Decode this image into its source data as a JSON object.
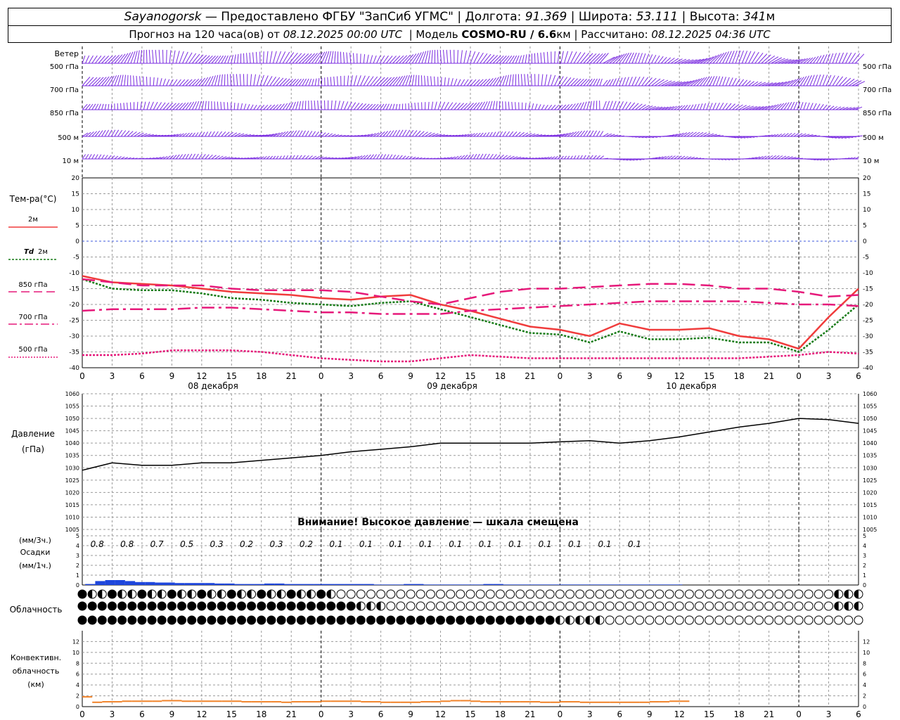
{
  "header": {
    "station": "Sayanogorsk",
    "provider": "— Предоставлено ФГБУ \"ЗапСиб УГМС\"",
    "lon_label": "Долгота:",
    "lon_value": "91.369",
    "lat_label": "Широта:",
    "lat_value": "53.111",
    "alt_label": "Высота:",
    "alt_value": "341",
    "alt_unit": "м",
    "forecast_label": "Прогноз на 120 часа(ов) от",
    "forecast_time": "08.12.2025 00:00 UTC",
    "model_label": "| Модель",
    "model_name": "COSMO-RU / 6.6",
    "model_unit": "км",
    "calc_label": "| Рассчитано:",
    "calc_time": "08.12.2025 04:36 UTC"
  },
  "wind_panel": {
    "title": "Ветер",
    "levels": [
      "500 гПа",
      "700 гПа",
      "850 гПа",
      "500 м",
      "10 м"
    ]
  },
  "time_axis": {
    "hour_labels": [
      "0",
      "3",
      "6",
      "9",
      "12",
      "15",
      "18",
      "21",
      "0",
      "3",
      "6",
      "9",
      "12",
      "15",
      "18",
      "21",
      "0",
      "3",
      "6",
      "9",
      "12",
      "15",
      "18",
      "21",
      "0",
      "3",
      "6"
    ],
    "date_labels": [
      "08 декабря",
      "09 декабря",
      "10 декабря"
    ],
    "day_boundaries": [
      0,
      24,
      48,
      72
    ]
  },
  "temp_legend": {
    "title": "Тем-ра(°С)",
    "t2m": "2м",
    "td_prefix": "Td",
    "td_suffix": "2м",
    "t850": "850 гПа",
    "t700": "700 гПа",
    "t500": "500 гПа"
  },
  "pressure_legend": {
    "line1": "Давление",
    "line2": "(гПа)",
    "warning": "Внимание! Высокое давление — шкала смещена"
  },
  "precip_legend": {
    "unit3h": "(мм/3ч.)",
    "title": "Осадки",
    "unit1h": "(мм/1ч.)"
  },
  "cloud_legend": {
    "title": "Облачность"
  },
  "conv_legend": {
    "line1": "Конвективн.",
    "line2": "облачность",
    "line3": "(км)"
  },
  "colors": {
    "wind": "#7a2be0",
    "t2m": "#f03c3c",
    "td": "#157a15",
    "t850": "#e6197a",
    "t700": "#e6197a",
    "t500": "#e6197a",
    "zero_line": "#3c5adc",
    "pressure": "#000000",
    "precip": "#1e46dc",
    "conv": "#f08228"
  },
  "chart_data": [
    {
      "type": "line",
      "title": "Тем-ра(°С)",
      "ylim": [
        -40,
        20
      ],
      "yticks": [
        20,
        15,
        10,
        5,
        0,
        -5,
        -10,
        -15,
        -20,
        -25,
        -30,
        -35,
        -40
      ],
      "x_hours": [
        0,
        3,
        6,
        9,
        12,
        15,
        18,
        21,
        24,
        27,
        30,
        33,
        36,
        39,
        42,
        45,
        48,
        51,
        54,
        57,
        60,
        63,
        66,
        69,
        72,
        75,
        78
      ],
      "series": [
        {
          "name": "2м",
          "values": [
            -11,
            -13,
            -13.5,
            -14,
            -15,
            -16,
            -16.5,
            -17,
            -18,
            -18.5,
            -17.5,
            -17,
            -20,
            -22,
            -24.5,
            -27,
            -28,
            -30,
            -26,
            -28,
            -28,
            -27.5,
            -30,
            -31,
            -34,
            -24,
            -15
          ]
        },
        {
          "name": "Td 2м",
          "values": [
            -12,
            -15,
            -15.5,
            -15.5,
            -16.5,
            -18,
            -18.5,
            -19.5,
            -20,
            -20.5,
            -19.5,
            -19,
            -21.5,
            -24,
            -26.5,
            -29,
            -29.5,
            -32,
            -28.5,
            -31,
            -31,
            -30.5,
            -32,
            -32,
            -35,
            -28,
            -20
          ]
        },
        {
          "name": "850 гПа",
          "values": [
            -12,
            -13,
            -14,
            -14,
            -14,
            -15,
            -15.5,
            -15.5,
            -15.5,
            -16,
            -17.5,
            -19,
            -20,
            -18,
            -16,
            -15,
            -15,
            -14.5,
            -14,
            -13.5,
            -13.5,
            -14,
            -15,
            -15,
            -16,
            -17.5,
            -17
          ]
        },
        {
          "name": "700 гПа",
          "values": [
            -22,
            -21.5,
            -21.5,
            -21.5,
            -21,
            -21,
            -21.5,
            -22,
            -22.5,
            -22.5,
            -23,
            -23,
            -23,
            -22,
            -21.5,
            -21,
            -20.5,
            -20,
            -19.5,
            -19,
            -19,
            -19,
            -19,
            -19.5,
            -20,
            -20,
            -20.5
          ]
        },
        {
          "name": "500 гПа",
          "values": [
            -36,
            -36,
            -35.5,
            -34.5,
            -34.5,
            -34.5,
            -35,
            -36,
            -37,
            -37.5,
            -38,
            -38,
            -37,
            -36,
            -36.5,
            -37,
            -37,
            -37,
            -37,
            -37,
            -37,
            -37,
            -37,
            -36.5,
            -36,
            -35,
            -35.5
          ]
        }
      ]
    },
    {
      "type": "line",
      "title": "Давление (гПа)",
      "ylim": [
        1005,
        1060
      ],
      "yticks": [
        1060,
        1055,
        1050,
        1045,
        1040,
        1035,
        1030,
        1025,
        1020,
        1015,
        1010,
        1005
      ],
      "x_hours": [
        0,
        3,
        6,
        9,
        12,
        15,
        18,
        21,
        24,
        27,
        30,
        33,
        36,
        39,
        42,
        45,
        48,
        51,
        54,
        57,
        60,
        63,
        66,
        69,
        72,
        75,
        78
      ],
      "series": [
        {
          "name": "Давление",
          "values": [
            1029,
            1032,
            1031,
            1031,
            1032,
            1032,
            1033,
            1034,
            1035,
            1036.5,
            1037.5,
            1038.5,
            1040,
            1040,
            1040,
            1040,
            1040.5,
            1041,
            1040,
            1041,
            1042.5,
            1044.5,
            1046.5,
            1048,
            1050,
            1049.5,
            1048
          ]
        }
      ]
    },
    {
      "type": "bar",
      "title": "Осадки",
      "ylim": [
        0,
        5
      ],
      "yticks": [
        5,
        4,
        3,
        2,
        1,
        0
      ],
      "labels_3h": [
        "0.8",
        "0.8",
        "0.7",
        "0.5",
        "0.3",
        "0.2",
        "0.3",
        "0.2",
        "0.1",
        "0.1",
        "0.1",
        "0.1",
        "0.1",
        "0.1",
        "0.1",
        "0.1",
        "0.1",
        "0.1",
        "0.1"
      ],
      "hourly_mm": [
        0.1,
        0.4,
        0.5,
        0.5,
        0.4,
        0.3,
        0.3,
        0.25,
        0.25,
        0.2,
        0.2,
        0.2,
        0.2,
        0.15,
        0.15,
        0.1,
        0.1,
        0.1,
        0.15,
        0.15,
        0.1,
        0.1,
        0.1,
        0.1,
        0.1,
        0.1,
        0.1,
        0.1,
        0.1,
        0.05,
        0.05,
        0.05,
        0.1,
        0.1,
        0.05,
        0.05,
        0.05,
        0.05,
        0.05,
        0.05,
        0.1,
        0.1,
        0.05,
        0.05,
        0.05,
        0.05,
        0.05,
        0.05,
        0.05,
        0.05,
        0.05,
        0.05,
        0.05,
        0.05,
        0.05,
        0.05,
        0.05,
        0.05,
        0.05,
        0.05
      ]
    },
    {
      "type": "bar",
      "title": "Конвективн. облачность (км)",
      "ylim": [
        0,
        14
      ],
      "yticks": [
        12,
        10,
        8,
        6,
        4,
        2,
        0
      ],
      "hourly_km": [
        1.8,
        0.8,
        0.9,
        0.9,
        1.0,
        1.0,
        1.0,
        1.0,
        1.1,
        1.1,
        1.0,
        1.0,
        1.0,
        1.0,
        1.0,
        1.0,
        0.9,
        0.9,
        0.9,
        0.9,
        0.8,
        0.9,
        0.9,
        0.9,
        1.0,
        1.0,
        1.0,
        1.0,
        0.9,
        0.9,
        0.8,
        0.8,
        0.8,
        0.8,
        0.9,
        0.9,
        1.0,
        1.1,
        1.1,
        1.0,
        0.9,
        0.9,
        0.9,
        0.9,
        0.9,
        0.9,
        0.8,
        0.8,
        0.9,
        0.9,
        0.8,
        0.8,
        0.8,
        0.8,
        0.8,
        0.8,
        0.8,
        0.9,
        0.9,
        1.0,
        1.0
      ]
    }
  ]
}
